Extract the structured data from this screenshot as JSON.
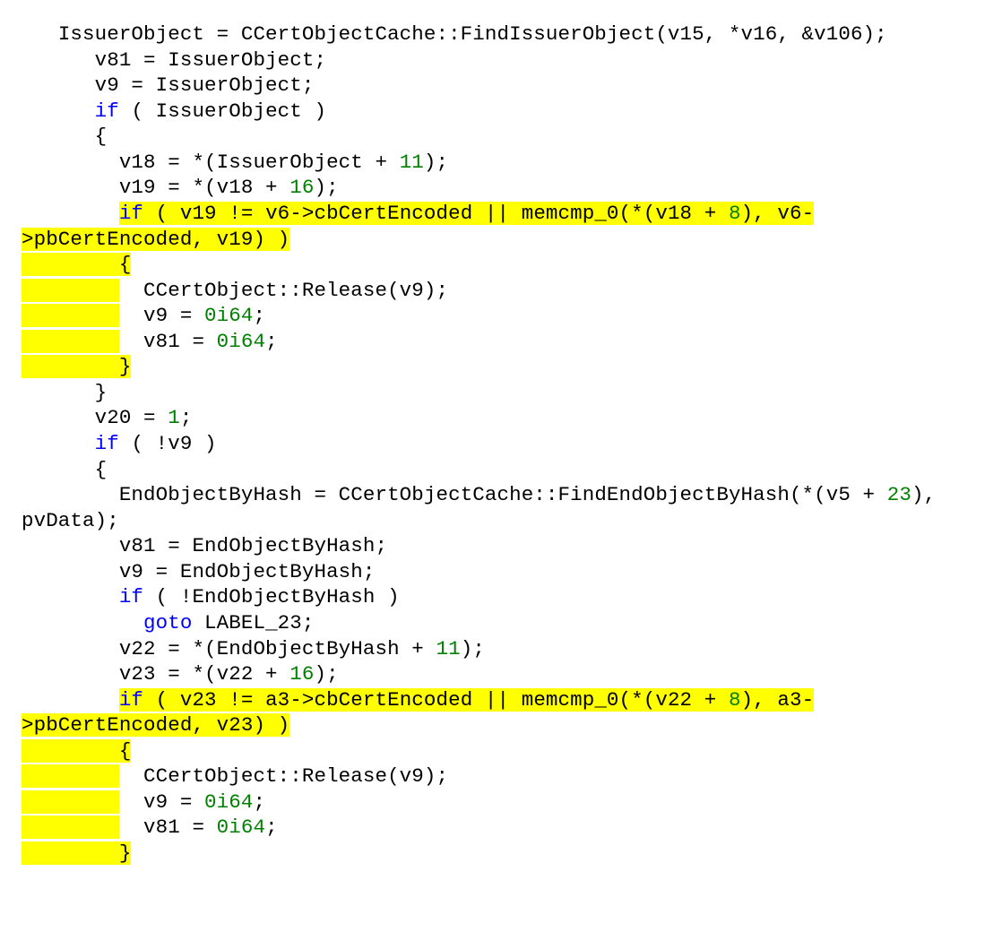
{
  "code": {
    "lines": [
      {
        "indent": "   ",
        "segments": [
          {
            "t": "IssuerObject = CCertObjectCache::FindIssuerObject(v15, *v16, &v106);"
          }
        ]
      },
      {
        "indent": "      ",
        "segments": [
          {
            "t": "v81 = IssuerObject;"
          }
        ]
      },
      {
        "indent": "      ",
        "segments": [
          {
            "t": "v9 = IssuerObject;"
          }
        ]
      },
      {
        "indent": "      ",
        "segments": [
          {
            "t": "if",
            "kw": true
          },
          {
            "t": " ( IssuerObject )"
          }
        ]
      },
      {
        "indent": "      ",
        "segments": [
          {
            "t": "{"
          }
        ]
      },
      {
        "indent": "        ",
        "segments": [
          {
            "t": "v18 = *(IssuerObject + "
          },
          {
            "t": "11",
            "num": true
          },
          {
            "t": ");"
          }
        ]
      },
      {
        "indent": "        ",
        "segments": [
          {
            "t": "v19 = *(v18 + "
          },
          {
            "t": "16",
            "num": true
          },
          {
            "t": ");"
          }
        ]
      },
      {
        "indent": "        ",
        "segments": [
          {
            "t": "if",
            "kw": true,
            "hl": true
          },
          {
            "t": " ( v19 != v6->cbCertEncoded || memcmp_0(*(v18 + ",
            "hl": true
          },
          {
            "t": "8",
            "num": true,
            "hl": true
          },
          {
            "t": "), v6-",
            "hl": true
          }
        ]
      },
      {
        "indent": "",
        "segments": [
          {
            "t": ">pbCertEncoded, v19) )",
            "hl": true
          }
        ]
      },
      {
        "indent": "",
        "segments": [
          {
            "t": "        {",
            "hl": true
          }
        ]
      },
      {
        "indent": "",
        "segments": [
          {
            "t": "        ",
            "hl": true
          },
          {
            "t": "  CCertObject::Release(v9);"
          }
        ]
      },
      {
        "indent": "",
        "segments": [
          {
            "t": "        ",
            "hl": true
          },
          {
            "t": "  v9 = "
          },
          {
            "t": "0i64",
            "num": true
          },
          {
            "t": ";"
          }
        ]
      },
      {
        "indent": "",
        "segments": [
          {
            "t": "        ",
            "hl": true
          },
          {
            "t": "  v81 = "
          },
          {
            "t": "0i64",
            "num": true
          },
          {
            "t": ";"
          }
        ]
      },
      {
        "indent": "",
        "segments": [
          {
            "t": "        }",
            "hl": true
          }
        ]
      },
      {
        "indent": "      ",
        "segments": [
          {
            "t": "}"
          }
        ]
      },
      {
        "indent": "      ",
        "segments": [
          {
            "t": "v20 = "
          },
          {
            "t": "1",
            "num": true
          },
          {
            "t": ";"
          }
        ]
      },
      {
        "indent": "      ",
        "segments": [
          {
            "t": "if",
            "kw": true
          },
          {
            "t": " ( !v9 )"
          }
        ]
      },
      {
        "indent": "      ",
        "segments": [
          {
            "t": "{"
          }
        ]
      },
      {
        "indent": "        ",
        "segments": [
          {
            "t": "EndObjectByHash = CCertObjectCache::FindEndObjectByHash(*(v5 + "
          },
          {
            "t": "23",
            "num": true
          },
          {
            "t": "),"
          }
        ]
      },
      {
        "indent": "",
        "segments": [
          {
            "t": "pvData);"
          }
        ]
      },
      {
        "indent": "        ",
        "segments": [
          {
            "t": "v81 = EndObjectByHash;"
          }
        ]
      },
      {
        "indent": "        ",
        "segments": [
          {
            "t": "v9 = EndObjectByHash;"
          }
        ]
      },
      {
        "indent": "        ",
        "segments": [
          {
            "t": "if",
            "kw": true
          },
          {
            "t": " ( !EndObjectByHash )"
          }
        ]
      },
      {
        "indent": "          ",
        "segments": [
          {
            "t": "goto",
            "kw": true
          },
          {
            "t": " LABEL_23;"
          }
        ]
      },
      {
        "indent": "        ",
        "segments": [
          {
            "t": "v22 = *(EndObjectByHash + "
          },
          {
            "t": "11",
            "num": true
          },
          {
            "t": ");"
          }
        ]
      },
      {
        "indent": "        ",
        "segments": [
          {
            "t": "v23 = *(v22 + "
          },
          {
            "t": "16",
            "num": true
          },
          {
            "t": ");"
          }
        ]
      },
      {
        "indent": "        ",
        "segments": [
          {
            "t": "if",
            "kw": true,
            "hl": true
          },
          {
            "t": " ( v23 != a3->cbCertEncoded || memcmp_0(*(v22 + ",
            "hl": true
          },
          {
            "t": "8",
            "num": true,
            "hl": true
          },
          {
            "t": "), a3-",
            "hl": true
          }
        ]
      },
      {
        "indent": "",
        "segments": [
          {
            "t": ">pbCertEncoded, v23) )",
            "hl": true
          }
        ]
      },
      {
        "indent": "",
        "segments": [
          {
            "t": "        {",
            "hl": true
          }
        ]
      },
      {
        "indent": "",
        "segments": [
          {
            "t": "        ",
            "hl": true
          },
          {
            "t": "  CCertObject::Release(v9);"
          }
        ]
      },
      {
        "indent": "",
        "segments": [
          {
            "t": "        ",
            "hl": true
          },
          {
            "t": "  v9 = "
          },
          {
            "t": "0i64",
            "num": true
          },
          {
            "t": ";"
          }
        ]
      },
      {
        "indent": "",
        "segments": [
          {
            "t": "        ",
            "hl": true
          },
          {
            "t": "  v81 = "
          },
          {
            "t": "0i64",
            "num": true
          },
          {
            "t": ";"
          }
        ]
      },
      {
        "indent": "",
        "segments": [
          {
            "t": "        }",
            "hl": true
          }
        ]
      }
    ]
  }
}
